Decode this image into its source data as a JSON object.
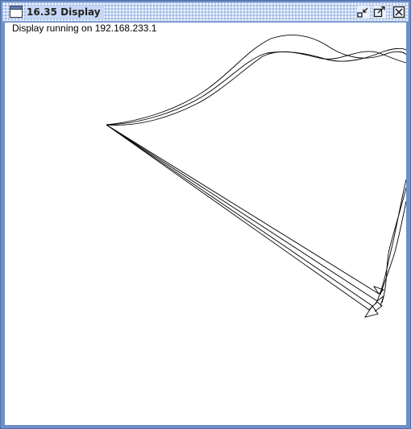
{
  "window": {
    "title": "16.35 Display"
  },
  "content": {
    "status_text": "Display running on 192.168.233.1"
  },
  "icons": {
    "app": "window-app-icon",
    "iconify": "iconify-icon",
    "maximize": "maximize-icon",
    "close": "close-icon"
  },
  "colors": {
    "frame": "#6e8fc7",
    "titlebar": "#c6d7f5",
    "canvas": "#ffffff",
    "stroke": "#000000"
  }
}
